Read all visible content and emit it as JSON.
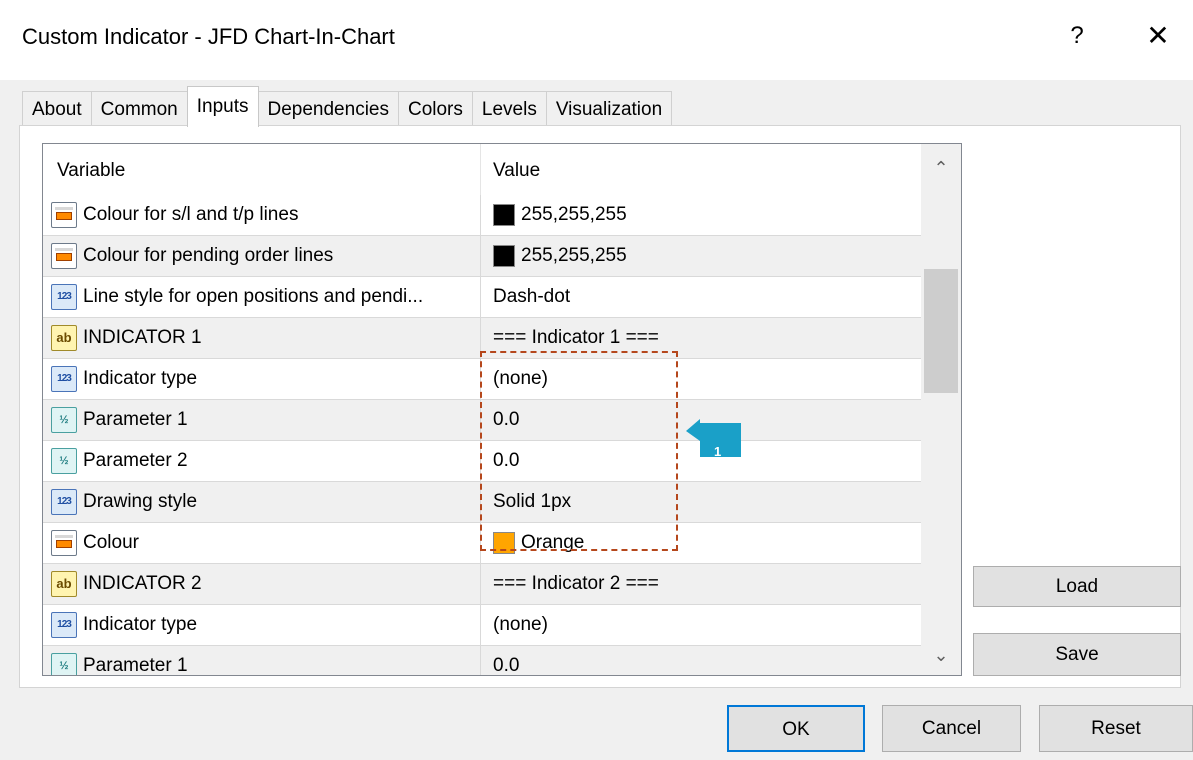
{
  "window": {
    "title": "Custom Indicator - JFD Chart-In-Chart",
    "help_label": "?",
    "close_label": "✕"
  },
  "tabs": [
    {
      "label": "About"
    },
    {
      "label": "Common"
    },
    {
      "label": "Inputs",
      "active": true
    },
    {
      "label": "Dependencies"
    },
    {
      "label": "Colors"
    },
    {
      "label": "Levels"
    },
    {
      "label": "Visualization"
    }
  ],
  "grid": {
    "header_variable": "Variable",
    "header_value": "Value",
    "rows": [
      {
        "icon": "color-icon",
        "variable": "Colour for s/l and t/p lines",
        "value": "255,255,255",
        "swatch": "#000000"
      },
      {
        "icon": "color-icon",
        "variable": "Colour for pending order lines",
        "value": "255,255,255",
        "swatch": "#000000"
      },
      {
        "icon": "integer-icon",
        "variable": "Line style for open positions and pendi...",
        "value": "Dash-dot"
      },
      {
        "icon": "string-icon",
        "variable": "INDICATOR 1",
        "value": "=== Indicator 1 ==="
      },
      {
        "icon": "integer-icon",
        "variable": "Indicator type",
        "value": "(none)"
      },
      {
        "icon": "double-icon",
        "variable": "Parameter 1",
        "value": "0.0"
      },
      {
        "icon": "double-icon",
        "variable": "Parameter 2",
        "value": "0.0"
      },
      {
        "icon": "integer-icon",
        "variable": "Drawing style",
        "value": "Solid 1px"
      },
      {
        "icon": "color-icon",
        "variable": "Colour",
        "value": "Orange",
        "swatch": "#ffa500"
      },
      {
        "icon": "string-icon",
        "variable": "INDICATOR 2",
        "value": "=== Indicator 2 ==="
      },
      {
        "icon": "integer-icon",
        "variable": "Indicator type",
        "value": "(none)"
      },
      {
        "icon": "double-icon",
        "variable": "Parameter 1",
        "value": "0.0"
      }
    ]
  },
  "icon_glyphs": {
    "integer": "123",
    "string": "ab",
    "double": "½"
  },
  "annotation": {
    "marker_number": "1",
    "marker_color": "#1aa0c8",
    "box_color": "#b5471c"
  },
  "buttons": {
    "load": "Load",
    "save": "Save",
    "ok": "OK",
    "cancel": "Cancel",
    "reset": "Reset"
  },
  "scrollbar": {
    "up": "⌃",
    "down": "⌄"
  }
}
